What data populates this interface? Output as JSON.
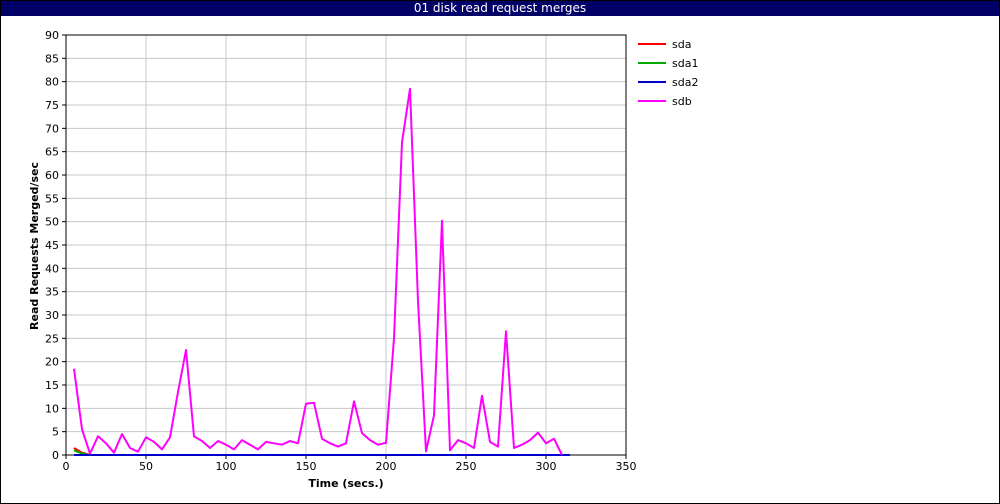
{
  "chart_data": {
    "type": "line",
    "title": "01 disk read request merges",
    "xlabel": "Time (secs.)",
    "ylabel": "Read Requests Merged/sec",
    "xlim": [
      0,
      350
    ],
    "ylim": [
      0,
      90
    ],
    "xticks": [
      0,
      50,
      100,
      150,
      200,
      250,
      300,
      350
    ],
    "yticks": [
      0,
      5,
      10,
      15,
      20,
      25,
      30,
      35,
      40,
      45,
      50,
      55,
      60,
      65,
      70,
      75,
      80,
      85,
      90
    ],
    "grid": true,
    "legend_position": "right",
    "series": [
      {
        "name": "sda",
        "color": "#ff0000",
        "x": [
          5,
          10,
          15,
          20,
          30,
          40,
          50,
          60,
          70,
          80,
          100,
          150,
          200,
          250,
          300,
          310,
          315
        ],
        "y": [
          1.5,
          0.5,
          0,
          0,
          0,
          0,
          0,
          0,
          0,
          0,
          0,
          0,
          0,
          0,
          0,
          0,
          0
        ]
      },
      {
        "name": "sda1",
        "color": "#00aa00",
        "x": [
          5,
          10,
          15,
          20,
          30,
          40,
          50,
          100,
          150,
          200,
          250,
          300,
          315
        ],
        "y": [
          1.0,
          0.3,
          0,
          0,
          0,
          0,
          0,
          0,
          0,
          0,
          0,
          0,
          0
        ]
      },
      {
        "name": "sda2",
        "color": "#0000cc",
        "x": [
          5,
          50,
          100,
          150,
          200,
          250,
          300,
          315
        ],
        "y": [
          0,
          0,
          0,
          0,
          0,
          0,
          0,
          0
        ]
      },
      {
        "name": "sdb",
        "color": "#ff00ff",
        "x": [
          5,
          10,
          15,
          20,
          25,
          30,
          35,
          40,
          45,
          50,
          55,
          60,
          65,
          70,
          75,
          80,
          85,
          90,
          95,
          100,
          105,
          110,
          115,
          120,
          125,
          130,
          135,
          140,
          145,
          150,
          155,
          160,
          165,
          170,
          175,
          180,
          185,
          190,
          195,
          200,
          205,
          210,
          215,
          220,
          225,
          230,
          235,
          240,
          245,
          250,
          255,
          260,
          265,
          270,
          275,
          280,
          285,
          290,
          295,
          300,
          305,
          310
        ],
        "y": [
          18.5,
          5.5,
          0.3,
          4.0,
          2.5,
          0.5,
          4.5,
          1.5,
          0.7,
          3.8,
          2.8,
          1.2,
          3.8,
          13.5,
          22.5,
          4.0,
          3.0,
          1.5,
          3.0,
          2.2,
          1.2,
          3.2,
          2.2,
          1.2,
          2.8,
          2.5,
          2.2,
          3.0,
          2.5,
          11.0,
          11.2,
          3.5,
          2.5,
          1.8,
          2.5,
          11.5,
          4.7,
          3.2,
          2.2,
          2.6,
          25.0,
          67.0,
          78.5,
          33.0,
          0.8,
          8.5,
          50.2,
          1.0,
          3.2,
          2.5,
          1.5,
          12.7,
          2.8,
          1.8,
          26.5,
          1.5,
          2.2,
          3.2,
          4.8,
          2.5,
          3.5,
          0
        ]
      }
    ]
  }
}
